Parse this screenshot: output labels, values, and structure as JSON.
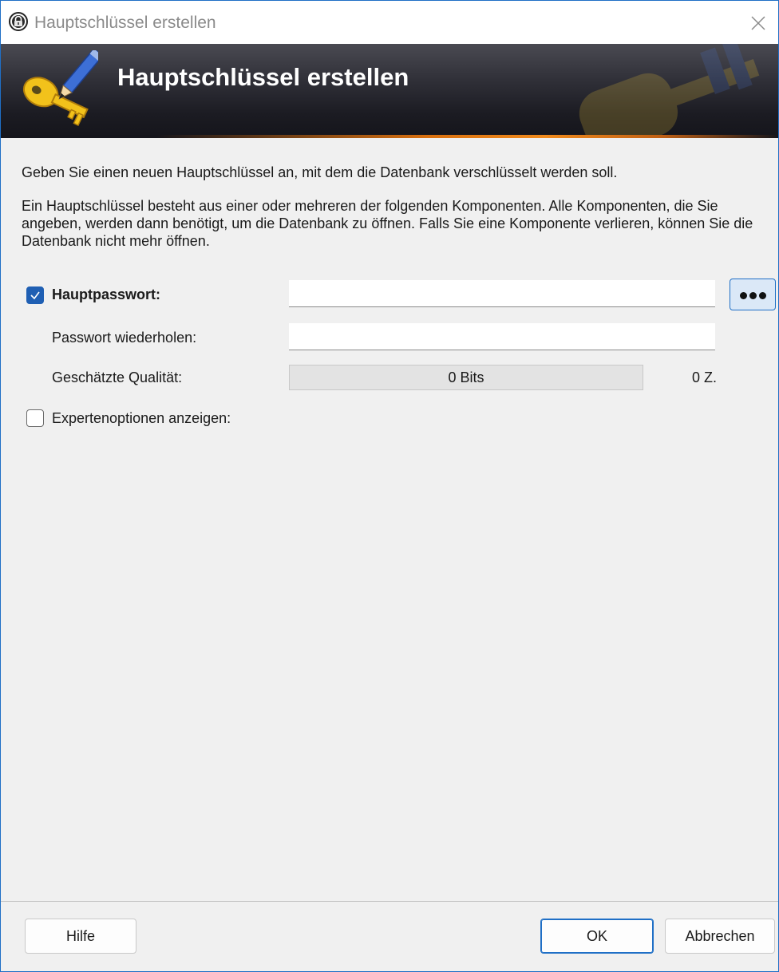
{
  "window": {
    "title": "Hauptschlüssel erstellen",
    "close_glyph": "×"
  },
  "banner": {
    "title": "Hauptschlüssel erstellen",
    "icon": "key-pencil-icon"
  },
  "intro": {
    "line1": "Geben Sie einen neuen Hauptschlüssel an, mit dem die Datenbank verschlüsselt werden soll.",
    "line2": "Ein Hauptschlüssel besteht aus einer oder mehreren der folgenden Komponenten. Alle Komponenten, die Sie angeben, werden dann benötigt, um die Datenbank zu öffnen. Falls Sie eine Komponente verlieren, können Sie die Datenbank nicht mehr öffnen."
  },
  "form": {
    "master_password": {
      "label": "Hauptpasswort:",
      "checked": true,
      "value": ""
    },
    "repeat_password": {
      "label": "Passwort wiederholen:",
      "value": ""
    },
    "quality": {
      "label": "Geschätzte Qualität:",
      "bits_text": "0 Bits",
      "chars_text": "0 Z.",
      "fill_percent": 0
    },
    "expert_options": {
      "label": "Expertenoptionen anzeigen:",
      "checked": false
    }
  },
  "buttons": {
    "help": "Hilfe",
    "ok": "OK",
    "cancel": "Abbrechen"
  },
  "colors": {
    "accent": "#1f6fc6",
    "checkbox_checked": "#1f5fb3",
    "banner_dark": "#1b1b22",
    "banner_stripe": "#f08a1c"
  }
}
